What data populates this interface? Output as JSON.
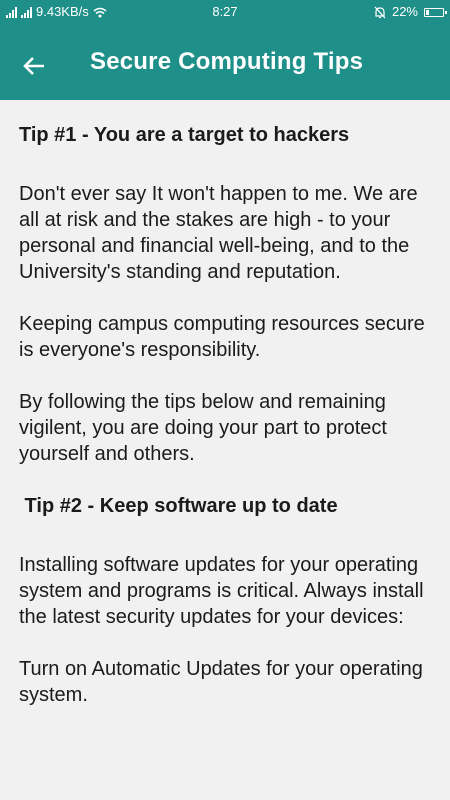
{
  "status_bar": {
    "network_speed": "9.43KB/s",
    "time": "8:27",
    "battery_percent": "22%",
    "battery_level": 0.22
  },
  "app_bar": {
    "title": "Secure Computing Tips",
    "back_icon": "arrow-back-icon"
  },
  "content": {
    "tip1_heading": "Tip #1 - You are a target to hackers",
    "tip1_p1": " Don't ever say It won't happen to me. We are all at risk and the stakes are high - to your personal and financial well-being, and to the University's standing and reputation.",
    "tip1_p2": " Keeping campus computing resources secure is everyone's responsibility.",
    "tip1_p3": " By following the tips below and remaining vigilent, you are doing your part to protect yourself and others.",
    "tip2_heading": " Tip #2 - Keep software up to date",
    "tip2_p1": " Installing software updates for your operating system and programs is critical. Always install the latest security updates for your devices:",
    "tip2_p2": " Turn on Automatic Updates for your operating system."
  },
  "colors": {
    "primary": "#1f8f89",
    "background": "#f1f1f1",
    "text": "#1b1b1b"
  }
}
